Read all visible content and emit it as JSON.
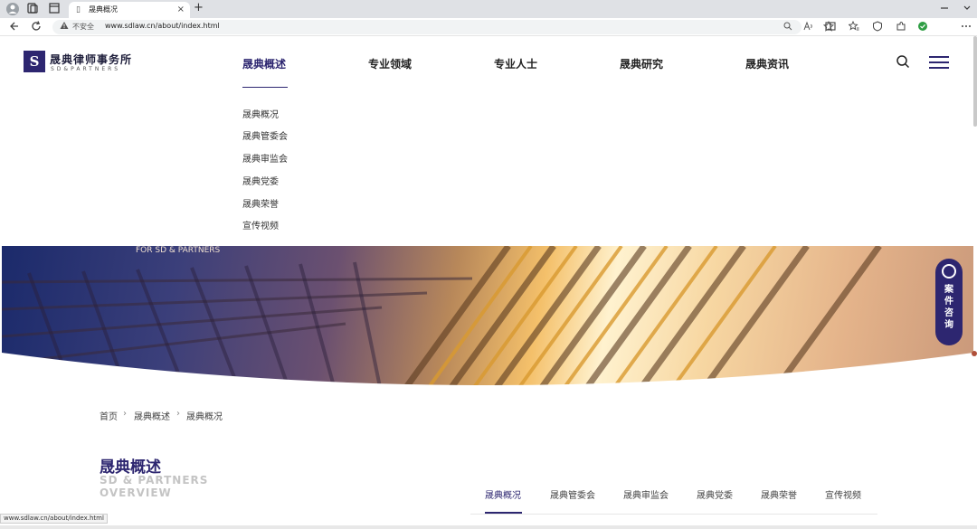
{
  "browser": {
    "tab_title": "晟典概况",
    "close_glyph": "×",
    "new_tab_glyph": "+",
    "not_secure": "不安全",
    "url": "www.sdlaw.cn/about/index.html",
    "status_url": "www.sdlaw.cn/about/index.html"
  },
  "header": {
    "logo_mark": "S",
    "logo_cn": "晟典律师事务所",
    "logo_en": "SD&PARTNERS",
    "nav": [
      {
        "label": "晟典概述"
      },
      {
        "label": "专业领域"
      },
      {
        "label": "专业人士"
      },
      {
        "label": "晟典研究"
      },
      {
        "label": "晟典资讯"
      }
    ]
  },
  "dropdown": [
    "晟典概况",
    "晟典管委会",
    "晟典审监会",
    "晟典党委",
    "晟典荣誉",
    "宣传视频"
  ],
  "banner": {
    "text": "FOR SD & PARTNERS"
  },
  "consult": {
    "label": "案件咨询"
  },
  "breadcrumb": {
    "items": [
      "首页",
      "晟典概述",
      "晟典概况"
    ],
    "sep": "›"
  },
  "section": {
    "title": "晟典概述",
    "en_line1": "SD & PARTNERS",
    "en_line2": "OVERVIEW",
    "tabs": [
      "晟典概况",
      "晟典管委会",
      "晟典审监会",
      "晟典党委",
      "晟典荣誉",
      "宣传视频"
    ]
  },
  "colors": {
    "brand": "#2d2670",
    "banner_warm": "#f4c06a",
    "banner_cool": "#1b2a6b"
  },
  "icons": [
    "profile-icon",
    "collections-icon",
    "tab-actions-icon",
    "back-icon",
    "refresh-icon",
    "warning-icon",
    "zoom-icon",
    "read-aloud-icon",
    "favorite-icon",
    "split-screen-icon",
    "favorites-bar-icon",
    "browser-essentials-icon",
    "extensions-icon",
    "more-icon",
    "search-icon",
    "menu-icon",
    "headset-icon"
  ]
}
